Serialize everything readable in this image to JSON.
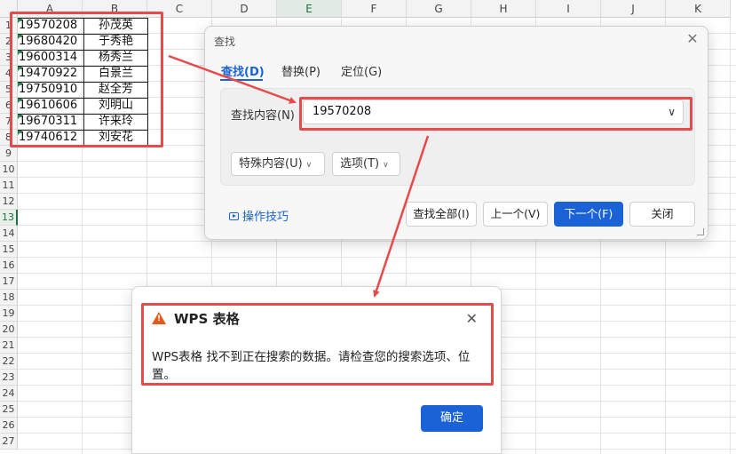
{
  "sheet": {
    "columns": [
      "A",
      "B",
      "C",
      "D",
      "E",
      "F",
      "G",
      "H",
      "I",
      "J",
      "K"
    ],
    "active_column": "E",
    "rows": [
      "1",
      "2",
      "3",
      "4",
      "5",
      "6",
      "7",
      "8",
      "9",
      "10",
      "11",
      "12",
      "13",
      "14",
      "15",
      "16",
      "17",
      "18",
      "19",
      "20",
      "21",
      "22",
      "23",
      "24",
      "25",
      "26",
      "27"
    ],
    "active_row": "13",
    "data": [
      {
        "a": "19570208",
        "b": "孙茂英"
      },
      {
        "a": "19680420",
        "b": "于秀艳"
      },
      {
        "a": "19600314",
        "b": "杨秀兰"
      },
      {
        "a": "19470922",
        "b": "白景兰"
      },
      {
        "a": "19750910",
        "b": "赵全芳"
      },
      {
        "a": "19610606",
        "b": "刘明山"
      },
      {
        "a": "19670311",
        "b": "许来玲"
      },
      {
        "a": "19740612",
        "b": "刘安花"
      }
    ]
  },
  "find_dialog": {
    "title": "查找",
    "tabs": [
      {
        "label": "查找(D)",
        "active": true
      },
      {
        "label": "替换(P)",
        "active": false
      },
      {
        "label": "定位(G)",
        "active": false
      }
    ],
    "find_label": "查找内容(N)",
    "find_value": "19570208",
    "special_button": "特殊内容(U)",
    "options_button": "选项(T)",
    "tips_label": "操作技巧",
    "buttons": {
      "find_all": "查找全部(I)",
      "prev": "上一个(V)",
      "next": "下一个(F)",
      "close": "关闭"
    }
  },
  "alert": {
    "title": "WPS 表格",
    "message": "WPS表格 找不到正在搜索的数据。请检查您的搜索选项、位置。",
    "ok": "确定"
  },
  "colors": {
    "accent": "#1a62d6",
    "annotation": "#e84a4a",
    "sheet_green": "#1e7145",
    "warning": "#e35a1c"
  }
}
